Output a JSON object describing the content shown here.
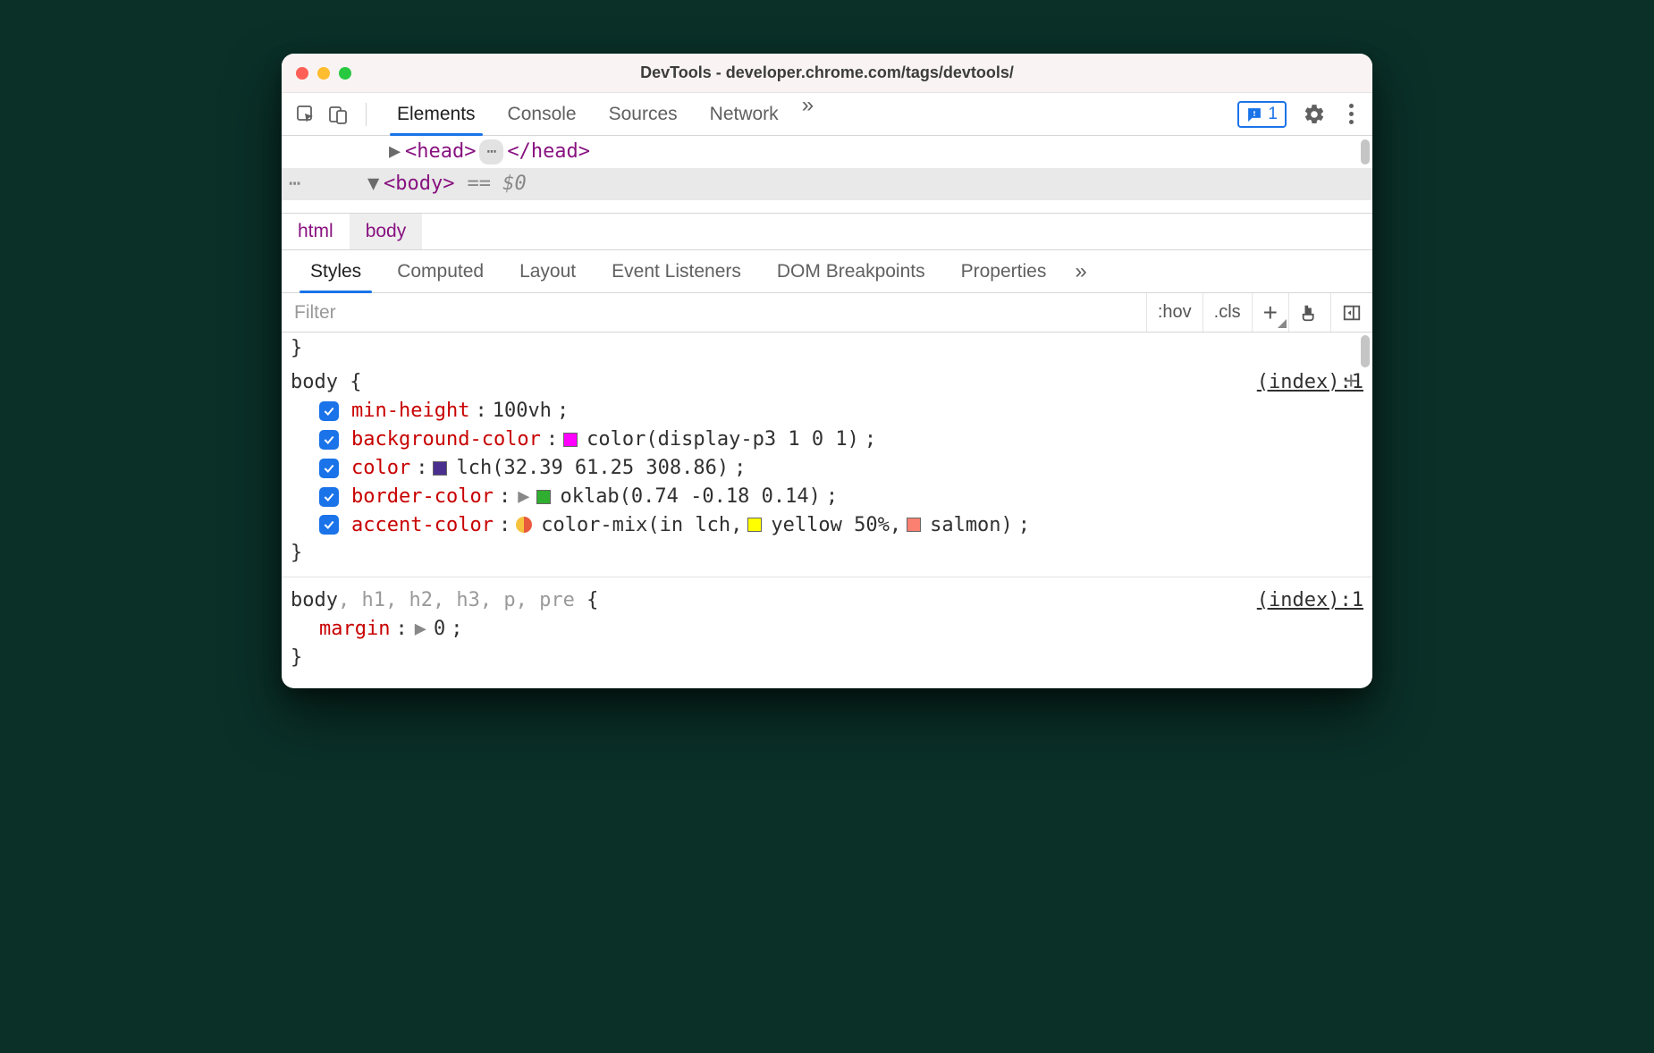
{
  "window": {
    "title": "DevTools - developer.chrome.com/tags/devtools/"
  },
  "toolbar": {
    "tabs": [
      "Elements",
      "Console",
      "Sources",
      "Network"
    ],
    "active_tab": "Elements",
    "overflow_glyph": "»",
    "issues_count": "1"
  },
  "dom": {
    "head_open": "<head>",
    "head_close": "</head>",
    "ellipsis_badge": "⋯",
    "body_open": "<body>",
    "selected_marker": "== $0",
    "dots": "⋯"
  },
  "breadcrumb": {
    "items": [
      "html",
      "body"
    ],
    "selected": "body"
  },
  "subtabs": {
    "items": [
      "Styles",
      "Computed",
      "Layout",
      "Event Listeners",
      "DOM Breakpoints",
      "Properties"
    ],
    "active": "Styles",
    "overflow_glyph": "»"
  },
  "filterbar": {
    "placeholder": "Filter",
    "hov": ":hov",
    "cls": ".cls"
  },
  "styles": {
    "prev_rule_close": "}",
    "rule1": {
      "selector": "body {",
      "source": "(index):1",
      "close": "}",
      "decls": [
        {
          "prop": "min-height",
          "value": "100vh",
          "swatch": null,
          "expand": false
        },
        {
          "prop": "background-color",
          "value": "color(display-p3 1 0 1)",
          "swatch": "#ff00ff",
          "expand": false
        },
        {
          "prop": "color",
          "value": "lch(32.39 61.25 308.86)",
          "swatch": "#4a2f8f",
          "expand": false
        },
        {
          "prop": "border-color",
          "value": "oklab(0.74 -0.18 0.14)",
          "swatch": "#2fae2f",
          "expand": true
        },
        {
          "prop": "accent-color",
          "value_prefix": "color-mix(in lch, ",
          "mix_a_color": "#ffff00",
          "mix_a_label": "yellow 50%",
          "mix_b_color": "#fa8072",
          "mix_b_label": "salmon",
          "value_suffix": ")",
          "mix": true,
          "mix_left": "#f6c23e",
          "mix_right": "#e85a3b"
        }
      ]
    },
    "rule2": {
      "selector_main": "body",
      "selector_dim": ", h1, h2, h3, p, pre",
      "brace": " {",
      "source": "(index):1",
      "decl": {
        "prop": "margin",
        "value": "0",
        "expand": true
      },
      "close": "}"
    }
  }
}
